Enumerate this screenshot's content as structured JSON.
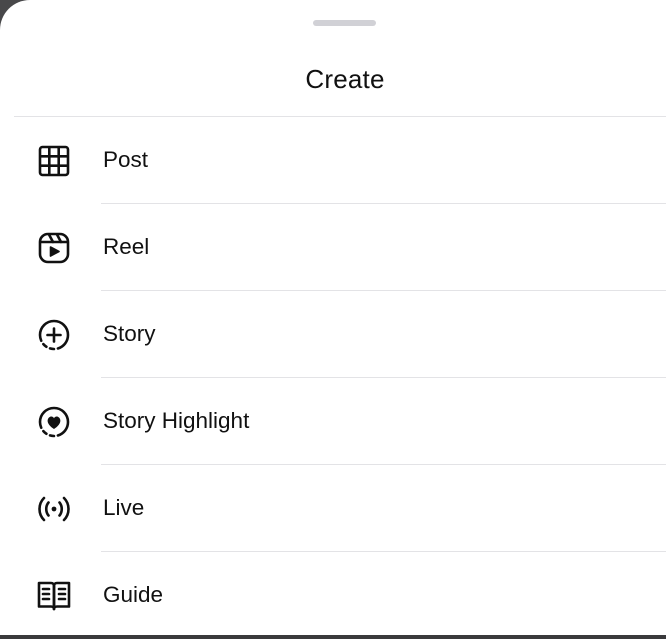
{
  "sheet": {
    "title": "Create"
  },
  "menu": {
    "items": [
      {
        "label": "Post",
        "icon": "grid-icon"
      },
      {
        "label": "Reel",
        "icon": "reel-icon"
      },
      {
        "label": "Story",
        "icon": "story-add-icon"
      },
      {
        "label": "Story Highlight",
        "icon": "story-highlight-icon"
      },
      {
        "label": "Live",
        "icon": "live-icon"
      },
      {
        "label": "Guide",
        "icon": "guide-icon"
      }
    ]
  },
  "colors": {
    "backdrop": "#3a3a3c",
    "sheet": "#ffffff",
    "text": "#111111",
    "separator": "#e3e3e6",
    "grabber": "#d1d1d6"
  }
}
